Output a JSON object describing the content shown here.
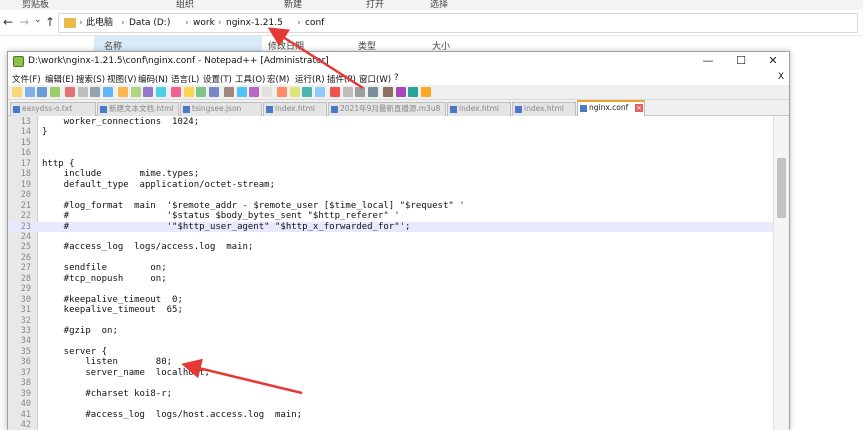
{
  "ribbon": {
    "items": [
      "剪贴板",
      "组织",
      "新建",
      "打开",
      "选择"
    ]
  },
  "explorer": {
    "nav": {
      "back": "←",
      "forward": "→",
      "dropdown": "⌄",
      "up": "↑"
    },
    "breadcrumb": [
      "此电脑",
      "Data (D:)",
      "work",
      "nginx-1.21.5",
      "conf"
    ],
    "separator": "›",
    "columns": {
      "name": "名称",
      "modified": "修改日期",
      "type": "类型",
      "size": "大小"
    }
  },
  "notepad": {
    "title": "D:\\work\\nginx-1.21.5\\conf\\nginx.conf - Notepad++ [Administrator]",
    "window_buttons": {
      "minimize": "—",
      "maximize": "☐",
      "close": "✕"
    },
    "menu_close": "X",
    "menu": [
      "文件(F)",
      "编辑(E)",
      "搜索(S)",
      "视图(V)",
      "编码(N)",
      "语言(L)",
      "设置(T)",
      "工具(O)",
      "宏(M)",
      "运行(R)",
      "插件(P)",
      "窗口(W)",
      "?"
    ],
    "tabs": [
      {
        "label": "easydss-o.txt",
        "active": false
      },
      {
        "label": "新建文本文档.html",
        "active": false
      },
      {
        "label": "tsingsee.json",
        "active": false
      },
      {
        "label": "index.html",
        "active": false
      },
      {
        "label": "2021年9月最新直播源.m3u8",
        "active": false
      },
      {
        "label": "index.html",
        "active": false
      },
      {
        "label": "index.html",
        "active": false
      },
      {
        "label": "nginx.conf",
        "active": true
      }
    ],
    "tab_close_glyph": "×",
    "lines": [
      {
        "n": "13",
        "t": "    worker_connections  1024;"
      },
      {
        "n": "14",
        "t": "}"
      },
      {
        "n": "15",
        "t": ""
      },
      {
        "n": "16",
        "t": ""
      },
      {
        "n": "17",
        "t": "http {"
      },
      {
        "n": "18",
        "t": "    include       mime.types;"
      },
      {
        "n": "19",
        "t": "    default_type  application/octet-stream;"
      },
      {
        "n": "20",
        "t": ""
      },
      {
        "n": "21",
        "t": "    #log_format  main  '$remote_addr - $remote_user [$time_local] \"$request\" '"
      },
      {
        "n": "22",
        "t": "    #                  '$status $body_bytes_sent \"$http_referer\" '"
      },
      {
        "n": "23",
        "t": "    #                  '\"$http_user_agent\" \"$http_x_forwarded_for\"';"
      },
      {
        "n": "24",
        "t": ""
      },
      {
        "n": "25",
        "t": "    #access_log  logs/access.log  main;"
      },
      {
        "n": "26",
        "t": ""
      },
      {
        "n": "27",
        "t": "    sendfile        on;"
      },
      {
        "n": "28",
        "t": "    #tcp_nopush     on;"
      },
      {
        "n": "29",
        "t": ""
      },
      {
        "n": "30",
        "t": "    #keepalive_timeout  0;"
      },
      {
        "n": "31",
        "t": "    keepalive_timeout  65;"
      },
      {
        "n": "32",
        "t": ""
      },
      {
        "n": "33",
        "t": "    #gzip  on;"
      },
      {
        "n": "34",
        "t": ""
      },
      {
        "n": "35",
        "t": "    server {"
      },
      {
        "n": "36",
        "t": "        listen       80;"
      },
      {
        "n": "37",
        "t": "        server_name  localhost;"
      },
      {
        "n": "38",
        "t": ""
      },
      {
        "n": "39",
        "t": "        #charset koi8-r;"
      },
      {
        "n": "40",
        "t": ""
      },
      {
        "n": "41",
        "t": "        #access_log  logs/host.access.log  main;"
      },
      {
        "n": "42",
        "t": ""
      }
    ],
    "highlight_line": "23"
  },
  "colors": {
    "accent": "#f0a030",
    "annotation_arrow": "#e53935",
    "line_highlight": "#e8e8ff",
    "selected_column": "#d9ebf9"
  }
}
